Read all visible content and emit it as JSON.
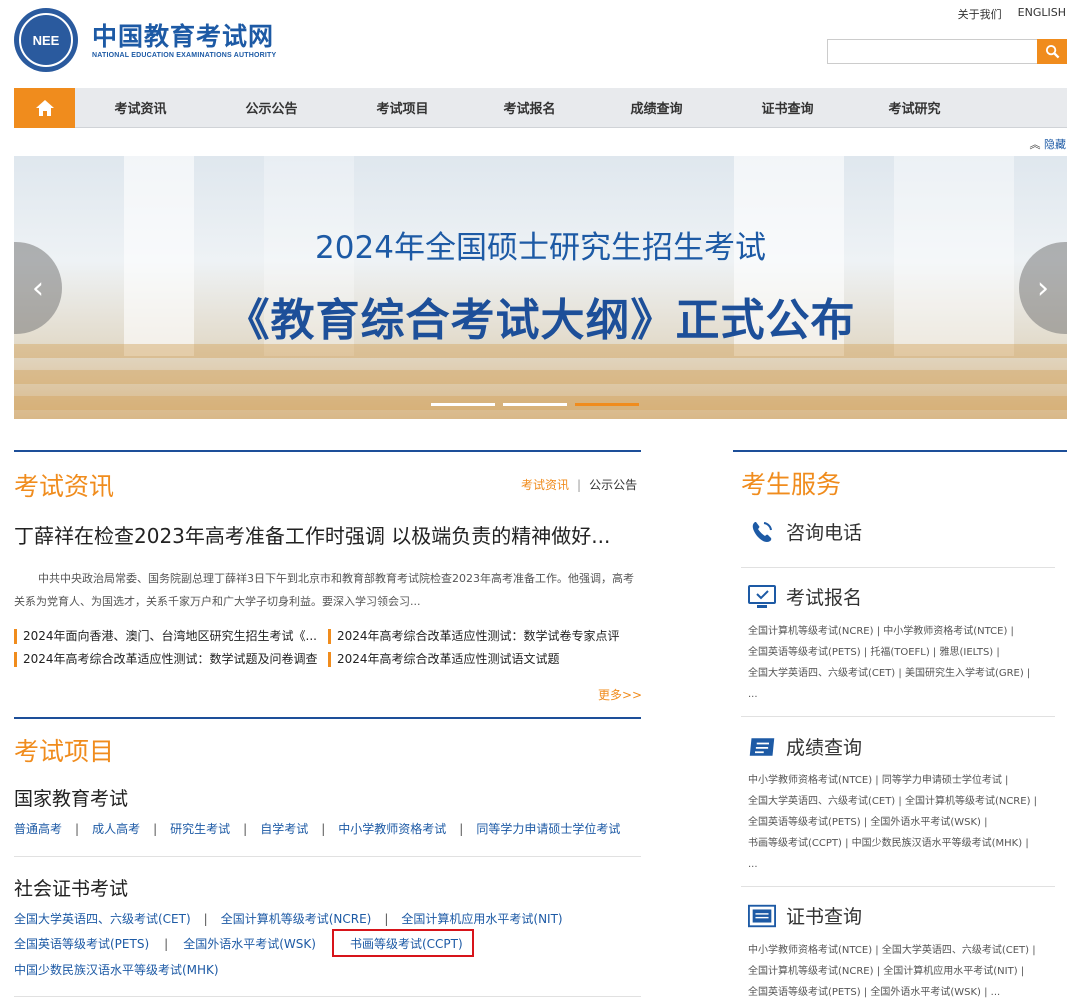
{
  "logo": {
    "emblem_text": "NEE",
    "cn": "中国教育考试网",
    "en": "NATIONAL EDUCATION EXAMINATIONS AUTHORITY"
  },
  "toplinks": {
    "about": "关于我们",
    "english": "ENGLISH"
  },
  "search": {
    "value": "",
    "icon": "search-icon"
  },
  "nav": {
    "home_icon": "home-icon",
    "items": [
      "考试资讯",
      "公示公告",
      "考试项目",
      "考试报名",
      "成绩查询",
      "证书查询",
      "考试研究"
    ]
  },
  "hide_label": "隐藏",
  "banner": {
    "line1": "2024年全国硕士研究生招生考试",
    "line2": "《教育综合考试大纲》正式公布",
    "slides_total": 3,
    "active_slide": 3
  },
  "exam_news": {
    "title": "考试资讯",
    "links": [
      "考试资讯",
      "公示公告"
    ],
    "headline": "丁薛祥在检查2023年高考准备工作时强调 以极端负责的精神做好...",
    "summary": "中共中央政治局常委、国务院副总理丁薛祥3日下午到北京市和教育部教育考试院检查2023年高考准备工作。他强调，高考关系为党育人、为国选才，关系千家万户和广大学子切身利益。要深入学习领会习...",
    "items": [
      "2024年面向香港、澳门、台湾地区研究生招生考试《...",
      "2024年高考综合改革适应性测试：数学试卷专家点评",
      "2024年高考综合改革适应性测试：数学试题及问卷调查",
      "2024年高考综合改革适应性测试语文试题"
    ],
    "more": "更多>>"
  },
  "exam_projects": {
    "title": "考试项目",
    "national": {
      "title": "国家教育考试",
      "links": [
        "普通高考",
        "成人高考",
        "研究生考试",
        "自学考试",
        "中小学教师资格考试",
        "同等学力申请硕士学位考试"
      ]
    },
    "social": {
      "title": "社会证书考试",
      "row1": [
        "全国大学英语四、六级考试(CET)",
        "全国计算机等级考试(NCRE)",
        "全国计算机应用水平考试(NIT)"
      ],
      "row2": [
        "全国英语等级考试(PETS)",
        "全国外语水平考试(WSK)",
        "书画等级考试(CCPT)"
      ],
      "row3": [
        "中国少数民族汉语水平等级考试(MHK)"
      ]
    }
  },
  "services": {
    "title": "考生服务",
    "phone": "咨询电话",
    "registration": {
      "title": "考试报名",
      "lines": [
        "全国计算机等级考试(NCRE) | 中小学教师资格考试(NTCE) |",
        "全国英语等级考试(PETS) | 托福(TOEFL) | 雅思(IELTS) |",
        "全国大学英语四、六级考试(CET) | 美国研究生入学考试(GRE) |",
        "..."
      ]
    },
    "scores": {
      "title": "成绩查询",
      "lines": [
        "中小学教师资格考试(NTCE) | 同等学力申请硕士学位考试 |",
        "全国大学英语四、六级考试(CET) | 全国计算机等级考试(NCRE) |",
        "全国英语等级考试(PETS) | 全国外语水平考试(WSK) |",
        "书画等级考试(CCPT) | 中国少数民族汉语水平等级考试(MHK) |",
        "..."
      ]
    },
    "certificates": {
      "title": "证书查询",
      "lines": [
        "中小学教师资格考试(NTCE) | 全国大学英语四、六级考试(CET) |",
        "全国计算机等级考试(NCRE) | 全国计算机应用水平考试(NIT) |",
        "全国英语等级考试(PETS) | 全国外语水平考试(WSK) | ..."
      ]
    }
  }
}
